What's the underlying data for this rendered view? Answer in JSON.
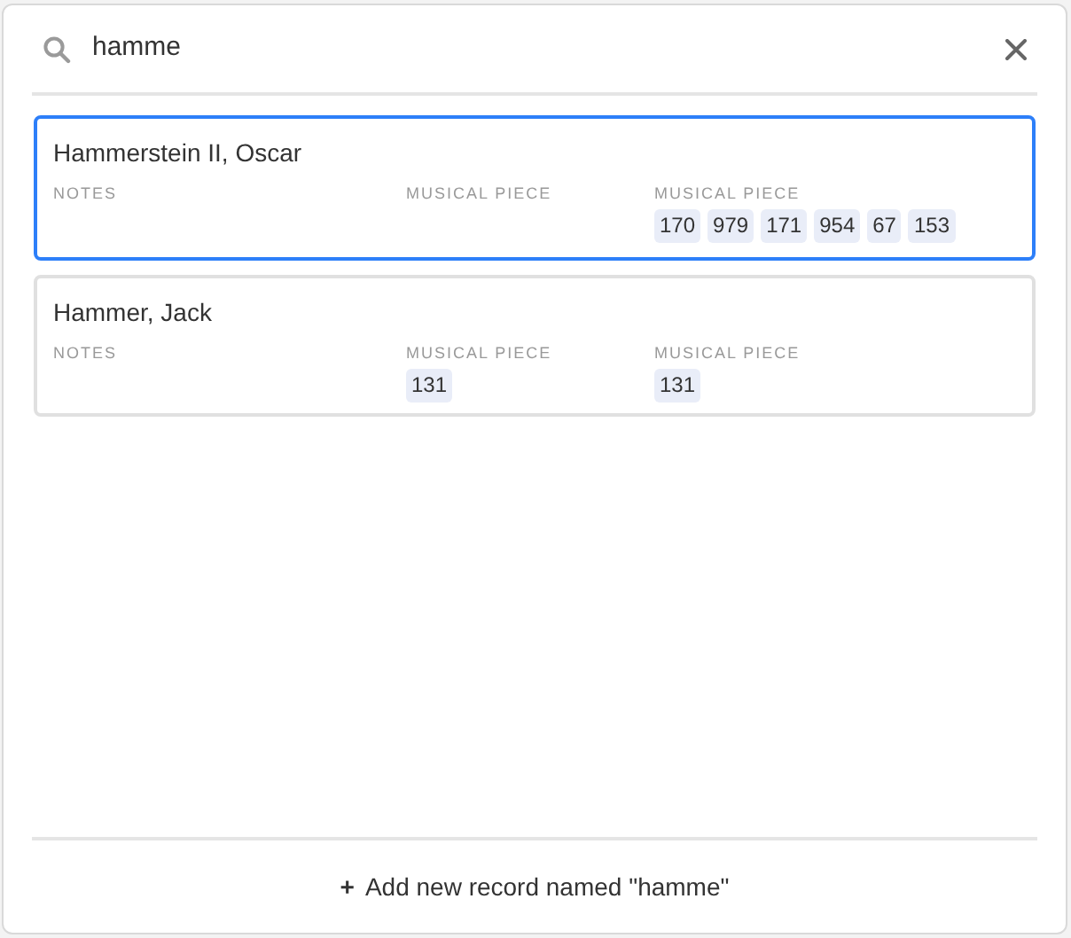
{
  "search": {
    "value": "hamme"
  },
  "records": [
    {
      "name": "Hammerstein II, Oscar",
      "selected": true,
      "fields": [
        {
          "label": "NOTES"
        },
        {
          "label": "MUSICAL PIECE"
        },
        {
          "label": "MUSICAL PIECE",
          "chips": [
            "170",
            "979",
            "171",
            "954",
            "67",
            "153"
          ]
        }
      ]
    },
    {
      "name": "Hammer, Jack",
      "selected": false,
      "fields": [
        {
          "label": "NOTES"
        },
        {
          "label": "MUSICAL PIECE",
          "chips": [
            "131"
          ]
        },
        {
          "label": "MUSICAL PIECE",
          "chips": [
            "131"
          ]
        }
      ]
    }
  ],
  "add_button": {
    "icon": "+",
    "label": "Add new record named \"hamme\""
  }
}
